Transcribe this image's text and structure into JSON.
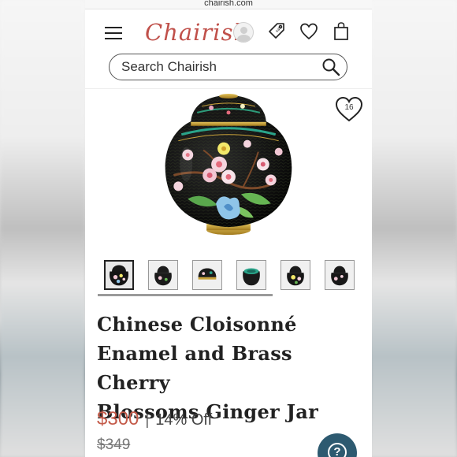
{
  "browser": {
    "url": "chairish.com"
  },
  "header": {
    "logo": "Chairish",
    "icons": [
      "menu-icon",
      "user-avatar-icon",
      "tag-icon",
      "heart-icon",
      "shopping-bag-icon"
    ]
  },
  "search": {
    "placeholder": "Search Chairish",
    "icon": "search-icon"
  },
  "product": {
    "favorite_count": "16",
    "title_lines": [
      "Chinese Cloisonné",
      "Enamel and Brass Cherry",
      "Blossoms Ginger Jar"
    ],
    "price": "$300",
    "separator": "|",
    "discount": "14% Off",
    "original_price": "$349",
    "thumbnail_count": 6
  },
  "help": {
    "icon": "question-mark-icon",
    "symbol": "?"
  },
  "colors": {
    "brand": "#c0504a",
    "price": "#c45b4a",
    "help_button": "#2d5a70",
    "jar_black": "#151515",
    "brass": "#c9a23a"
  }
}
